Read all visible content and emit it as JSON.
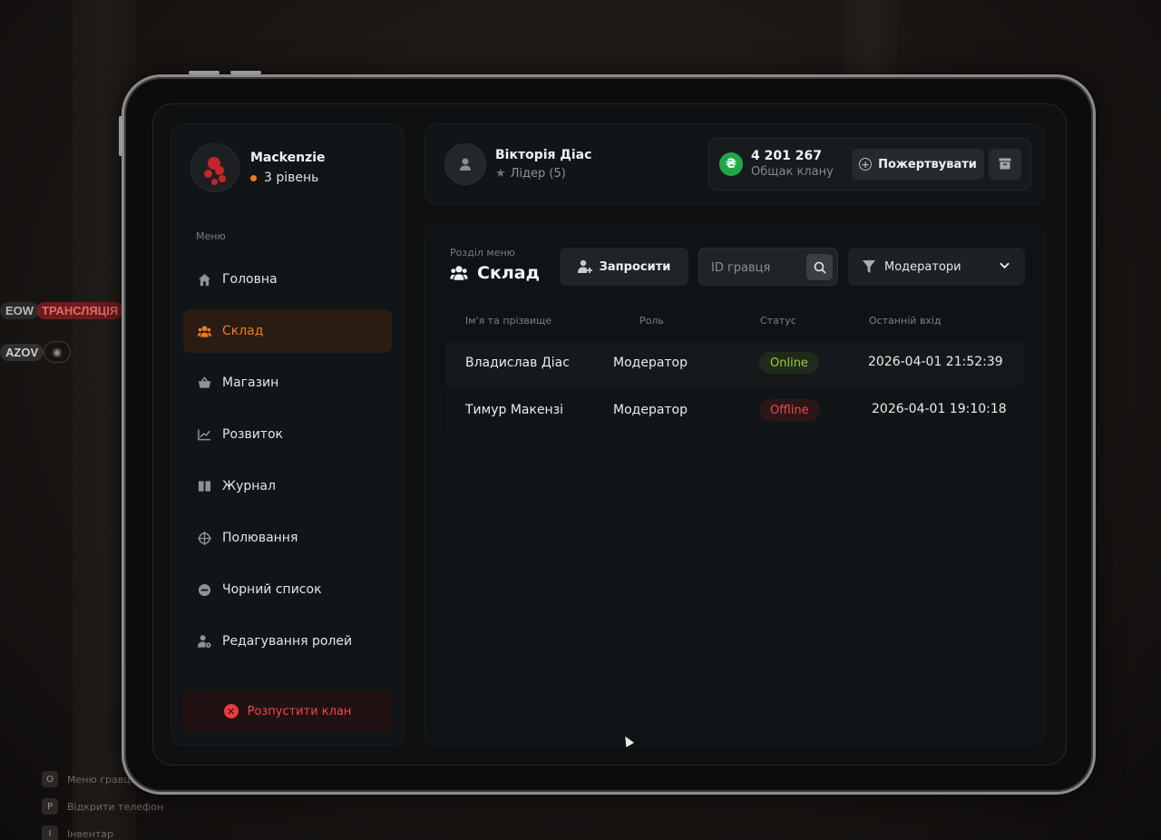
{
  "background": {
    "hud_tags": [
      "EOW",
      "ТРАНСЛЯЦІЯ",
      "AZOV"
    ],
    "hints": [
      {
        "key": "O",
        "label": "Меню гравця"
      },
      {
        "key": "P",
        "label": "Відкрити телефон"
      },
      {
        "key": "I",
        "label": "Інвентар"
      }
    ]
  },
  "profile": {
    "name": "Mackenzie",
    "level": "3 рівень"
  },
  "sidebar": {
    "caption": "Меню",
    "items": [
      {
        "label": "Головна",
        "icon": "home-icon"
      },
      {
        "label": "Склад",
        "icon": "users-icon",
        "active": true
      },
      {
        "label": "Магазин",
        "icon": "basket-icon"
      },
      {
        "label": "Розвиток",
        "icon": "chart-icon"
      },
      {
        "label": "Журнал",
        "icon": "book-icon"
      },
      {
        "label": "Полювання",
        "icon": "crosshair-icon"
      },
      {
        "label": "Чорний список",
        "icon": "block-icon"
      },
      {
        "label": "Редагування ролей",
        "icon": "user-gear-icon"
      }
    ],
    "disband_label": "Розпустити клан"
  },
  "header": {
    "leader_name": "Вікторія Діас",
    "leader_role": "Лідер (5)",
    "bank_amount": "4 201 267",
    "bank_label": "Общак клану",
    "currency_symbol": "₴",
    "donate_label": "Пожертвувати"
  },
  "main": {
    "section_caption": "Розділ меню",
    "section_title": "Склад",
    "invite_label": "Запросити",
    "search_placeholder": "ID гравця",
    "filter_value": "Модератори",
    "columns": [
      "Ім'я та прізвище",
      "Роль",
      "Статус",
      "Останній вхід"
    ],
    "rows": [
      {
        "name": "Владислав Діас",
        "role": "Модератор",
        "status": "Online",
        "last_login": "2026-04-01 21:52:39"
      },
      {
        "name": "Тимур Макензі",
        "role": "Модератор",
        "status": "Offline",
        "last_login": "2026-04-01 19:10:18"
      }
    ]
  },
  "colors": {
    "accent": "#f07b1e",
    "online": "#9ccf3f",
    "offline": "#ea4b4b",
    "bank_coin": "#22a64a"
  }
}
